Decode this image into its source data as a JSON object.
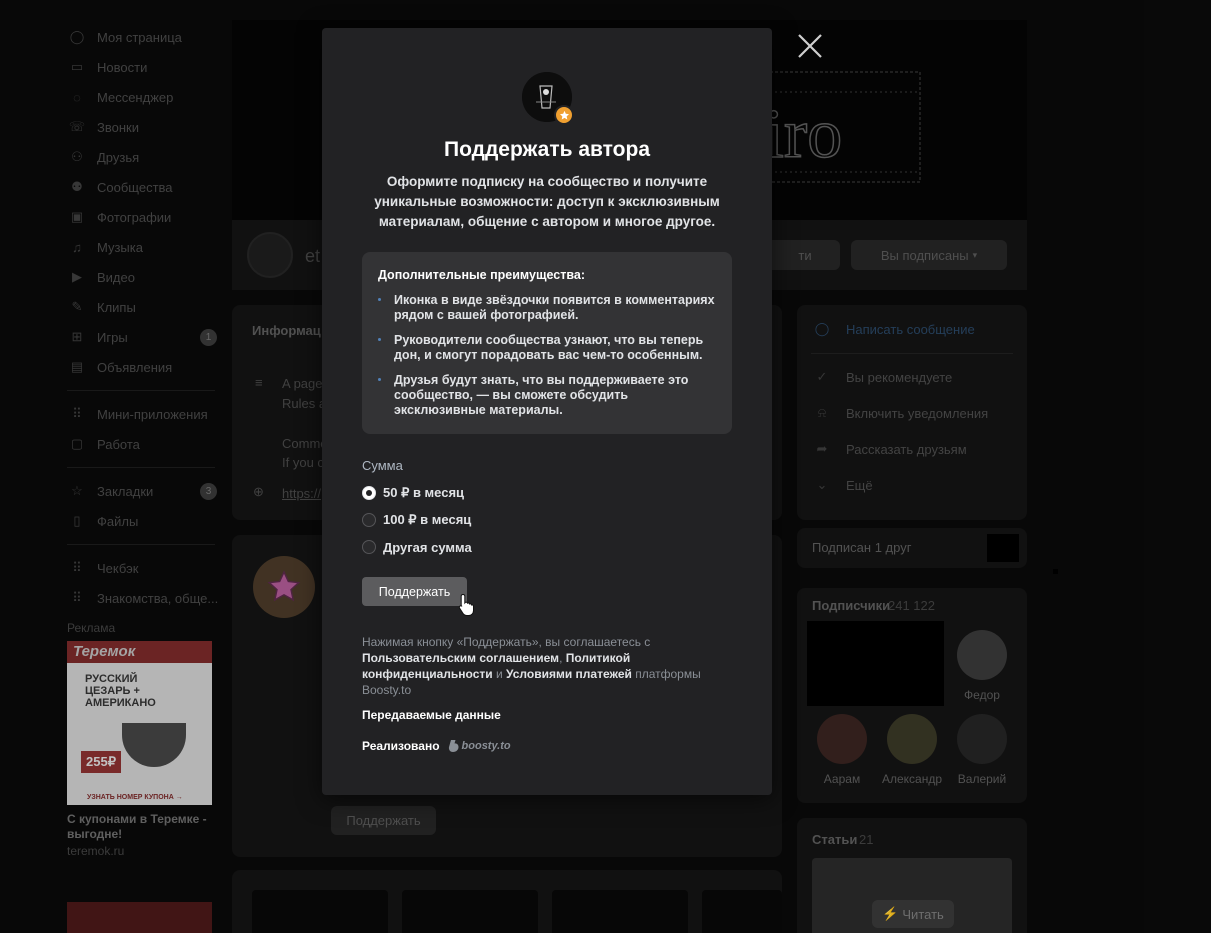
{
  "left_nav": {
    "items": [
      {
        "label": "Моя страница",
        "icon": "user-circle-icon"
      },
      {
        "label": "Новости",
        "icon": "news-icon"
      },
      {
        "label": "Мессенджер",
        "icon": "chat-icon"
      },
      {
        "label": "Звонки",
        "icon": "phone-icon"
      },
      {
        "label": "Друзья",
        "icon": "friends-icon"
      },
      {
        "label": "Сообщества",
        "icon": "communities-icon"
      },
      {
        "label": "Фотографии",
        "icon": "photo-icon"
      },
      {
        "label": "Музыка",
        "icon": "music-icon"
      },
      {
        "label": "Видео",
        "icon": "video-icon"
      },
      {
        "label": "Клипы",
        "icon": "clips-icon"
      },
      {
        "label": "Игры",
        "icon": "gamepad-icon",
        "badge": "1"
      },
      {
        "label": "Объявления",
        "icon": "classifieds-icon"
      }
    ],
    "items2": [
      {
        "label": "Мини-приложения",
        "icon": "apps-icon"
      },
      {
        "label": "Работа",
        "icon": "briefcase-icon"
      }
    ],
    "items3": [
      {
        "label": "Закладки",
        "icon": "star-icon",
        "badge": "3"
      },
      {
        "label": "Файлы",
        "icon": "file-icon"
      }
    ],
    "items4": [
      {
        "label": "Чекбэк",
        "icon": "apps-icon"
      },
      {
        "label": "Знакомства, обще...",
        "icon": "apps-icon"
      }
    ]
  },
  "ad": {
    "label": "Реклама",
    "image_brand": "Теремок",
    "image_text": "РУССКИЙ ЦЕЗАРЬ + АМЕРИКАНО",
    "image_price": "255₽",
    "image_cta": "УЗНАТЬ НОМЕР КУПОНА →",
    "title": "С купонами в Теремке - выгодне!",
    "domain": "teremok.ru"
  },
  "community": {
    "name": "et",
    "subscribed_label": "Вы подписаны",
    "button2_fragment": "ти",
    "tab_info": "Информац",
    "about_lines": [
      "A page",
      "Rules a",
      "Comme",
      "If you c"
    ],
    "link_fragment": "https://",
    "support_bg_button": "Поддержать"
  },
  "right_actions": [
    {
      "label": "Написать сообщение",
      "icon": "message-icon",
      "link": true
    },
    {
      "label": "Вы рекомендуете",
      "icon": "check-icon"
    },
    {
      "label": "Включить уведомления",
      "icon": "bell-icon"
    },
    {
      "label": "Рассказать друзьям",
      "icon": "share-icon"
    },
    {
      "label": "Ещё",
      "icon": "chevron-down-icon"
    }
  ],
  "friends_card": {
    "label": "Подписан 1 друг"
  },
  "subscribers": {
    "label": "Подписчики",
    "count": "241 122",
    "people": [
      "Федор",
      "Аарам",
      "Александр",
      "Валерий"
    ]
  },
  "articles": {
    "label": "Статьи",
    "count": "21",
    "read_button": "Читать"
  },
  "modal": {
    "title": "Поддержать автора",
    "description": "Оформите подписку на сообщество и получите уникальные возможности: доступ к эксклюзивным материалам, общение с автором и многое другое.",
    "benefits_title": "Дополнительные преимущества:",
    "benefits": [
      "Иконка в виде звёздочки появится в комментариях рядом с вашей фотографией.",
      "Руководители сообщества узнают, что вы теперь дон, и смогут порадовать вас чем-то особенным.",
      "Друзья будут знать, что вы поддерживаете это сообщество, — вы сможете обсудить эксклюзивные материалы."
    ],
    "amount_label": "Сумма",
    "options": [
      {
        "label": "50 ₽ в месяц",
        "checked": true
      },
      {
        "label": "100 ₽ в месяц",
        "checked": false
      },
      {
        "label": "Другая сумма",
        "checked": false
      }
    ],
    "support_button": "Поддержать",
    "legal_prefix": "Нажимая кнопку «Поддержать», вы соглашаетесь с",
    "legal_link1": "Пользовательским соглашением",
    "legal_link2": "Политикой конфиденциальности",
    "legal_and": "и",
    "legal_link3": "Условиями платежей",
    "legal_suffix": "платформы Boosty.to",
    "data_link": "Передаваемые данные",
    "powered_by": "Реализовано",
    "boosty_logo_text": "boosty.to"
  },
  "colors": {
    "modal_bg": "#222224",
    "benefits_bg": "#333335",
    "accent_bullet": "#5181b8",
    "badge_star": "#f0a030"
  }
}
